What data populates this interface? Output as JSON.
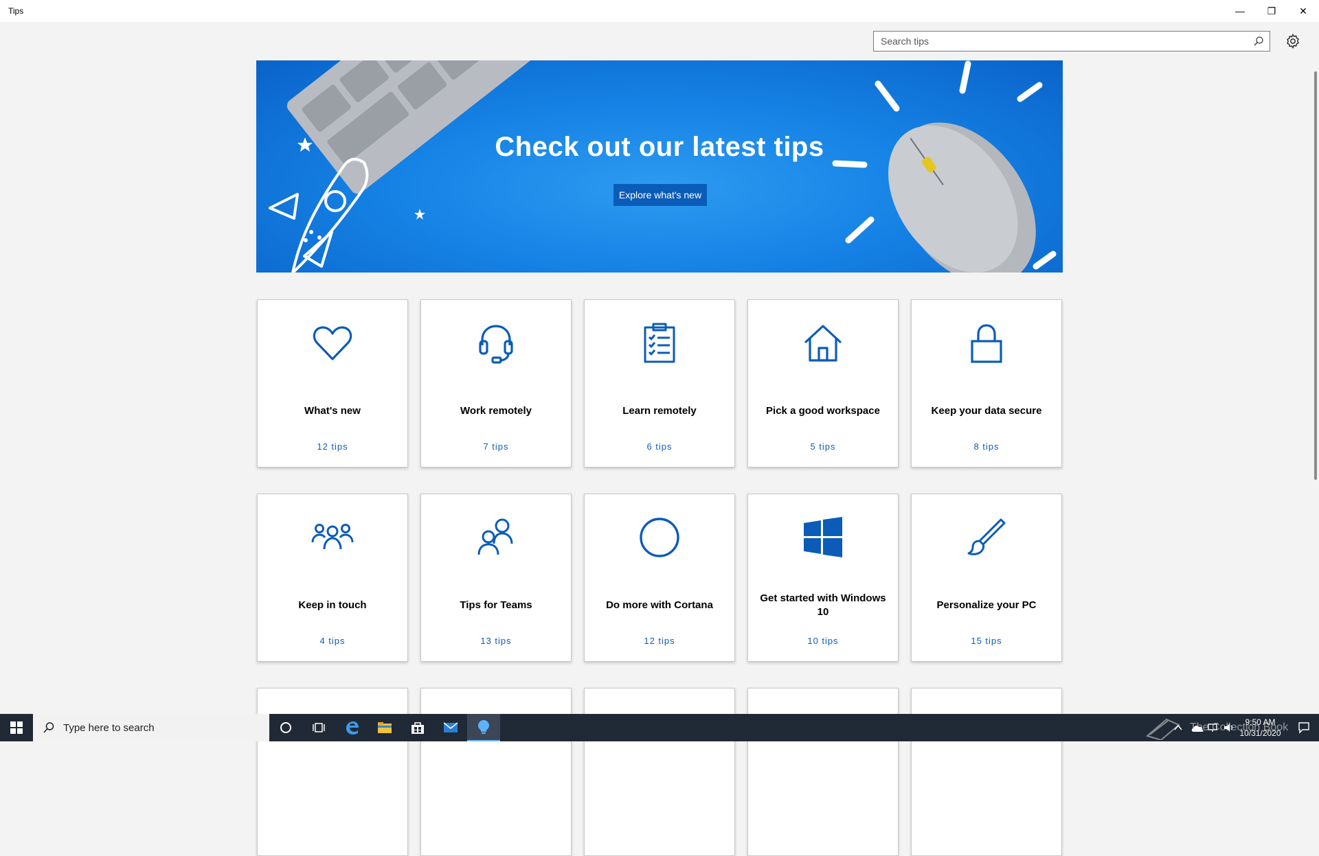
{
  "window": {
    "title": "Tips",
    "minimize": "—",
    "maximize": "❐",
    "close": "✕"
  },
  "search": {
    "placeholder": "Search tips"
  },
  "hero": {
    "headline": "Check out our latest tips",
    "cta": "Explore what's new"
  },
  "cards": [
    {
      "label": "What's new",
      "count": "12 tips",
      "icon": "heart-icon"
    },
    {
      "label": "Work remotely",
      "count": "7 tips",
      "icon": "headset-icon"
    },
    {
      "label": "Learn remotely",
      "count": "6 tips",
      "icon": "clipboard-checklist-icon"
    },
    {
      "label": "Pick a good workspace",
      "count": "5 tips",
      "icon": "home-icon"
    },
    {
      "label": "Keep your data secure",
      "count": "8 tips",
      "icon": "lock-icon"
    },
    {
      "label": "Keep in touch",
      "count": "4 tips",
      "icon": "people-group-icon"
    },
    {
      "label": "Tips for Teams",
      "count": "13 tips",
      "icon": "teams-people-icon"
    },
    {
      "label": "Do more with Cortana",
      "count": "12 tips",
      "icon": "cortana-circle-icon"
    },
    {
      "label": "Get started with Windows 10",
      "count": "10 tips",
      "icon": "windows-logo-icon"
    },
    {
      "label": "Personalize your PC",
      "count": "15 tips",
      "icon": "paintbrush-icon"
    }
  ],
  "taskbar": {
    "search_placeholder": "Type here to search",
    "time": "9:50 AM",
    "date": "10/31/2020",
    "watermark": "The Collection Book"
  },
  "colors": {
    "accent": "#0a5cb8",
    "hero": "#1683e6",
    "taskbar": "#202a36"
  }
}
